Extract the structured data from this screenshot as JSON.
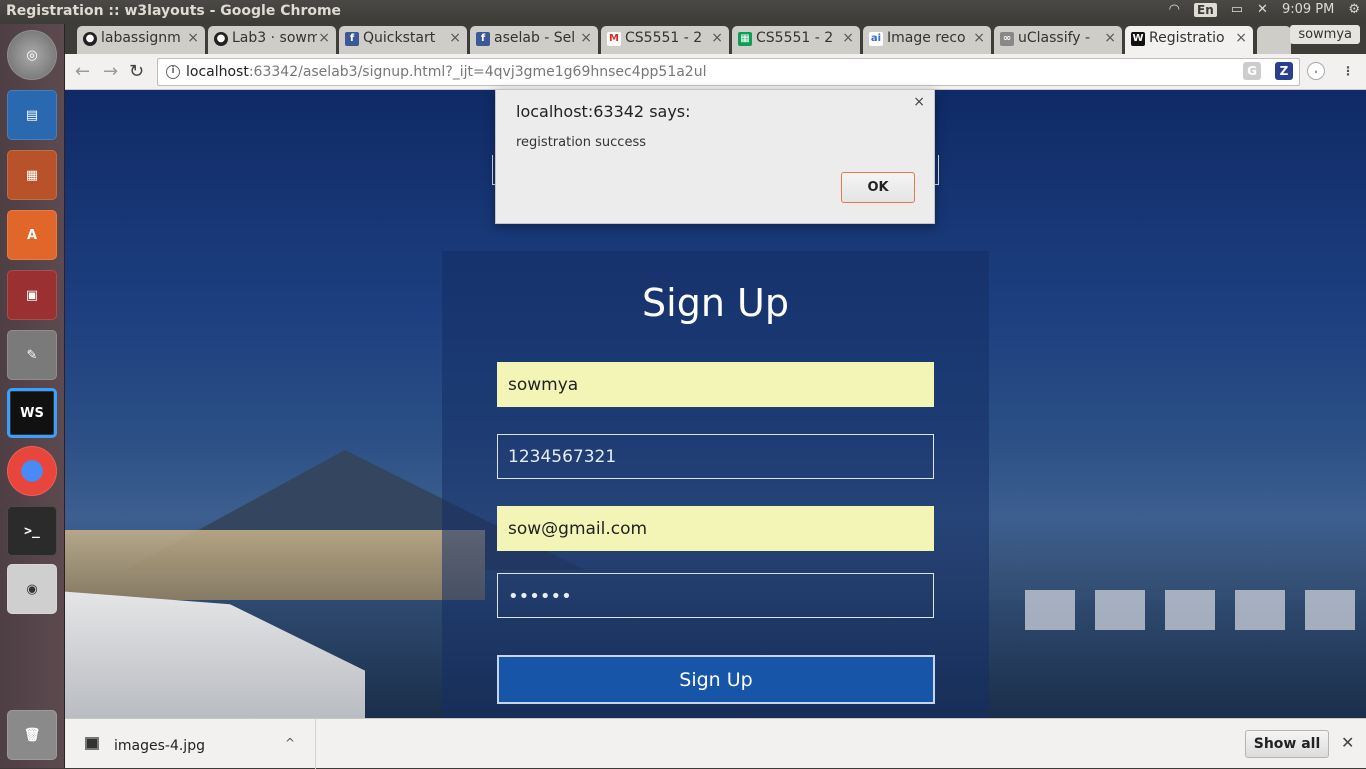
{
  "system": {
    "window_title": "Registration :: w3layouts - Google Chrome",
    "language": "En",
    "time": "9:09 PM"
  },
  "browser": {
    "tabs": [
      {
        "label": "labassignm",
        "favicon": "github-icon"
      },
      {
        "label": "Lab3 · sowm",
        "favicon": "github-icon"
      },
      {
        "label": "Quickstart",
        "favicon": "facebook-icon"
      },
      {
        "label": "aselab - Sel",
        "favicon": "facebook-icon"
      },
      {
        "label": "CS5551 - 2",
        "favicon": "gmail-icon"
      },
      {
        "label": "CS5551 - 2",
        "favicon": "sheets-icon"
      },
      {
        "label": "Image reco",
        "favicon": "ai-icon"
      },
      {
        "label": "uClassify - ",
        "favicon": "uclassify-icon"
      },
      {
        "label": "Registratio",
        "favicon": "webstorm-icon"
      }
    ],
    "profile": "sowmya",
    "url_host": "localhost",
    "url_rest": ":63342/aselab3/signup.html?_ijt=4qvj3gme1g69hnsec4pp51a2ul"
  },
  "dialog": {
    "title": "localhost:63342 says:",
    "message": "registration success",
    "ok_label": "OK",
    "close": "×"
  },
  "form": {
    "heading": "Sign Up",
    "username": "sowmya",
    "phone": "1234567321",
    "email": "sow@gmail.com",
    "password_mask": "••••••",
    "submit_label": "Sign Up"
  },
  "downloads": {
    "file_name": "images-4.jpg",
    "show_all_label": "Show all"
  },
  "colors": {
    "accent": "#1655a8",
    "autofill": "#f2f5b6",
    "ok_border": "#e07a4f"
  }
}
